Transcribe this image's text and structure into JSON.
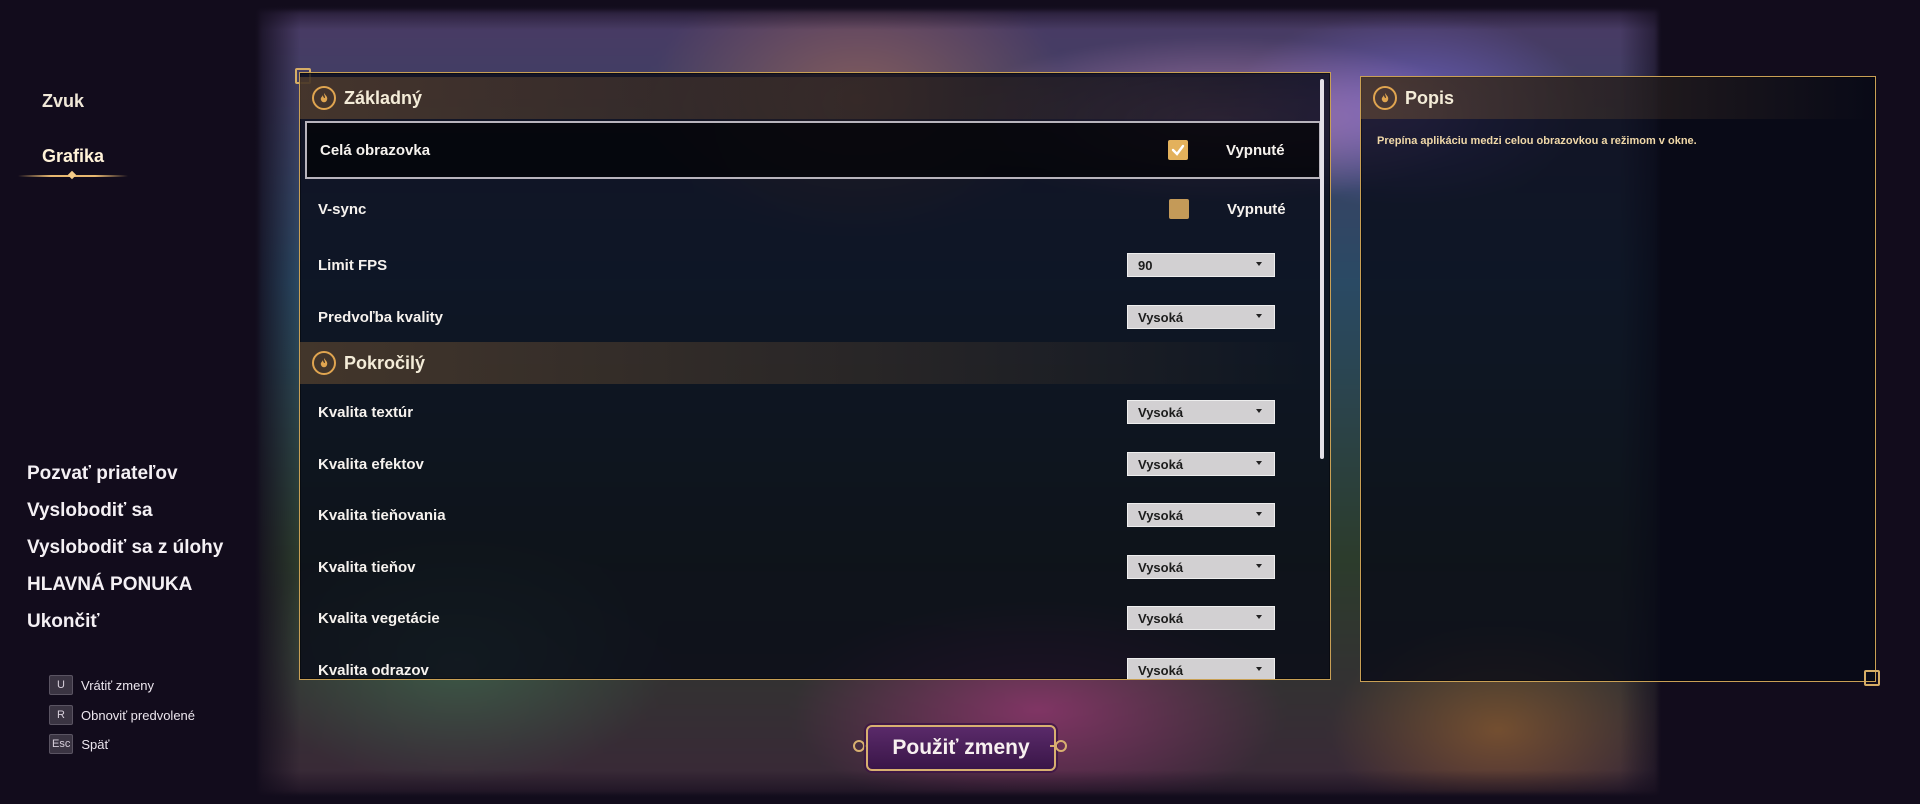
{
  "side_tabs": [
    {
      "label": "Zvuk"
    },
    {
      "label": "Grafika",
      "active": true
    }
  ],
  "pause_menu": [
    {
      "label": "Pozvať priateľov"
    },
    {
      "label": "Vyslobodiť sa"
    },
    {
      "label": "Vyslobodiť sa z úlohy"
    },
    {
      "label": "HLAVNÁ PONUKA"
    },
    {
      "label": "Ukončiť"
    }
  ],
  "hints": [
    {
      "key": "U",
      "label": "Vrátiť zmeny"
    },
    {
      "key": "R",
      "label": "Obnoviť predvolené"
    },
    {
      "key": "Esc",
      "label": "Späť"
    }
  ],
  "sections": {
    "basic_title": "Základný",
    "advanced_title": "Pokročilý"
  },
  "settings": {
    "fullscreen": {
      "label": "Celá obrazovka",
      "checked": true,
      "state": "Vypnuté"
    },
    "vsync": {
      "label": "V-sync",
      "checked": false,
      "state": "Vypnuté"
    },
    "fps_limit": {
      "label": "Limit FPS",
      "value": "90"
    },
    "quality_preset": {
      "label": "Predvoľba kvality",
      "value": "Vysoká"
    },
    "texture_quality": {
      "label": "Kvalita textúr",
      "value": "Vysoká"
    },
    "effects_quality": {
      "label": "Kvalita efektov",
      "value": "Vysoká"
    },
    "shading_quality": {
      "label": "Kvalita tieňovania",
      "value": "Vysoká"
    },
    "shadow_quality": {
      "label": "Kvalita tieňov",
      "value": "Vysoká"
    },
    "vegetation_quality": {
      "label": "Kvalita vegetácie",
      "value": "Vysoká"
    },
    "reflection_quality": {
      "label": "Kvalita odrazov",
      "value": "Vysoká"
    }
  },
  "description": {
    "title": "Popis",
    "text": "Prepína aplikáciu medzi celou obrazovkou a režimom v okne."
  },
  "apply_button": {
    "label": "Použiť zmeny"
  },
  "colors": {
    "accent_gold": "#c9a055",
    "checkbox": "#e3b15c",
    "apply_bg": "#4a205a"
  }
}
